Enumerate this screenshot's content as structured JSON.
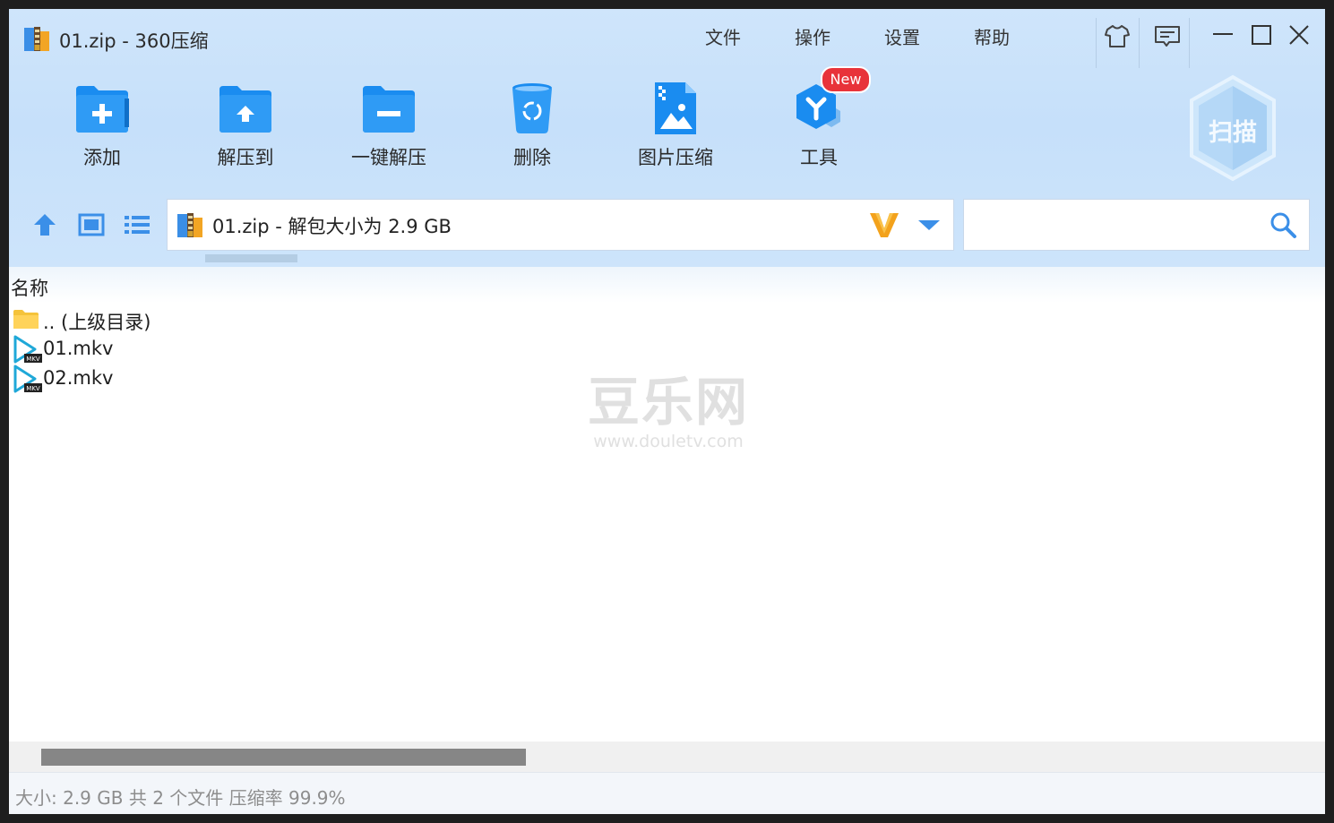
{
  "window": {
    "title": "01.zip - 360压缩"
  },
  "menu": [
    "文件",
    "操作",
    "设置",
    "帮助"
  ],
  "toolbar": {
    "add": "添加",
    "extract_to": "解压到",
    "one_click": "一键解压",
    "delete": "删除",
    "image_compress": "图片压缩",
    "tools": "工具",
    "new_badge": "New",
    "scan": "扫描"
  },
  "address": {
    "text": "01.zip - 解包大小为 2.9 GB",
    "v_mark": "V"
  },
  "search": {
    "value": "",
    "placeholder": ""
  },
  "list": {
    "column_name": "名称",
    "items": [
      {
        "name": ".. (上级目录)",
        "icon": "folder-icon"
      },
      {
        "name": "01.mkv",
        "icon": "mkv-file-icon",
        "badge": "MKV"
      },
      {
        "name": "02.mkv",
        "icon": "mkv-file-icon",
        "badge": "MKV"
      }
    ]
  },
  "watermark": {
    "title": "豆乐网",
    "url": "www.douletv.com"
  },
  "status": {
    "text": "大小: 2.9 GB 共 2 个文件 压缩率 99.9%"
  },
  "colors": {
    "accent": "#1a8cf0",
    "top_bg": "#cae2fa",
    "badge_red": "#e8333a",
    "v_orange": "#f3a21c"
  }
}
